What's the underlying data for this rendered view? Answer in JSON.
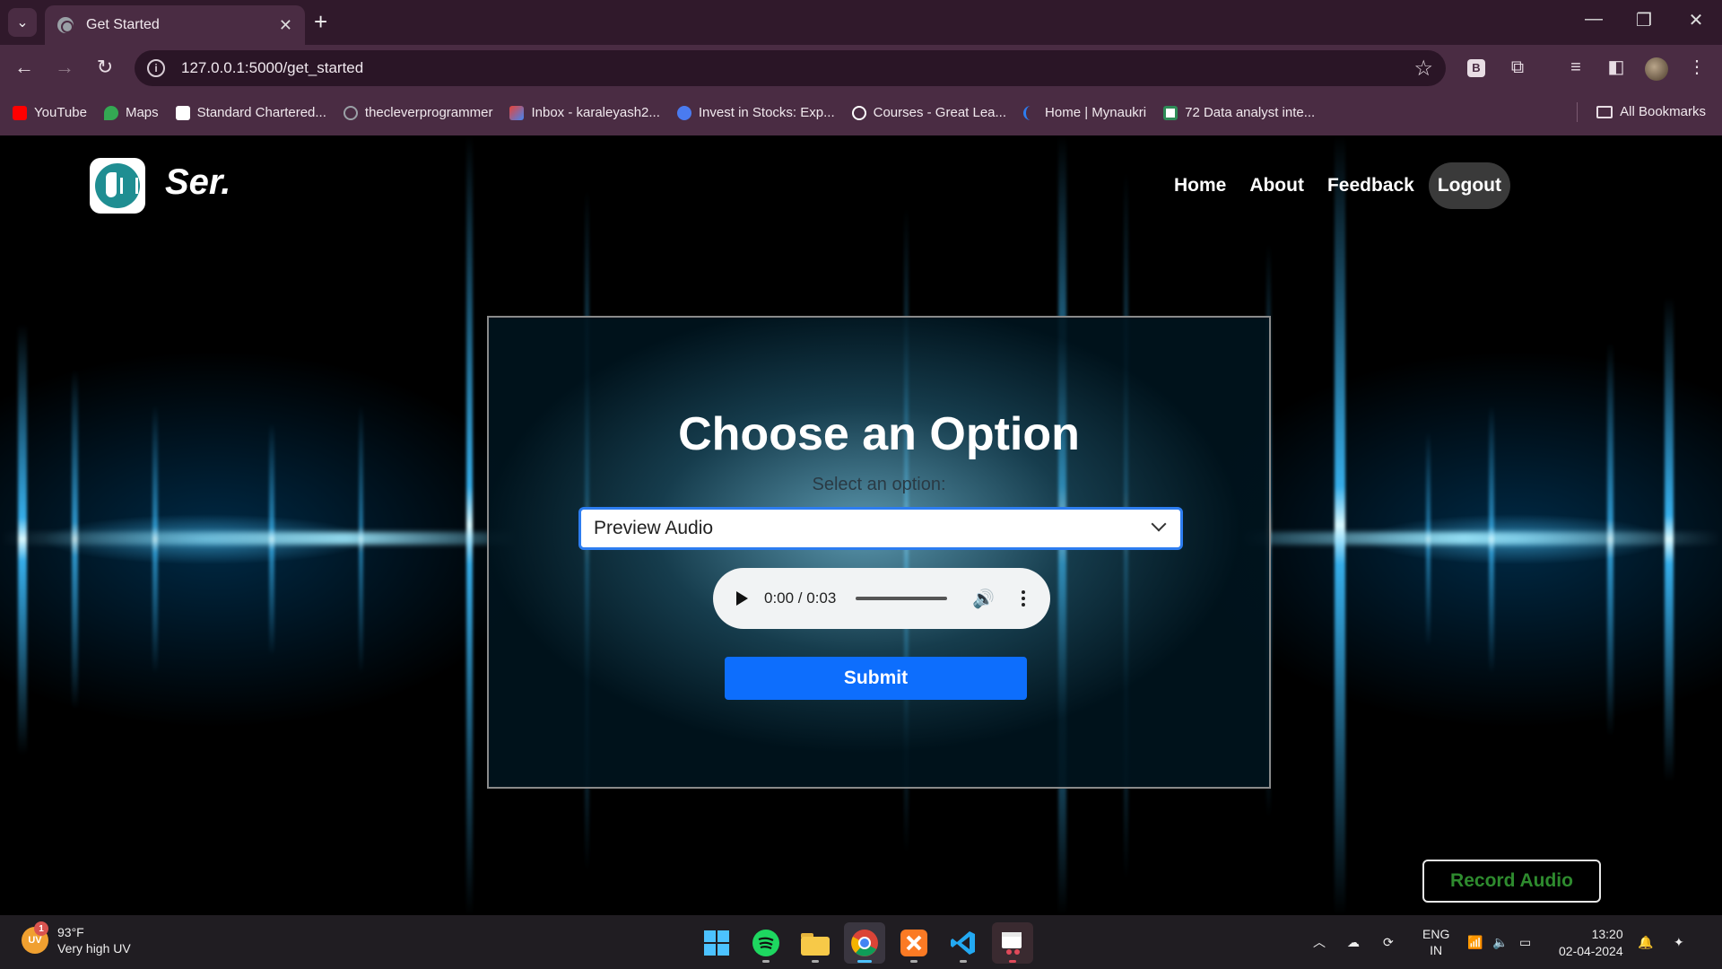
{
  "browser": {
    "tab_title": "Get Started",
    "url": "127.0.0.1:5000/get_started",
    "bookmarks": [
      {
        "label": "YouTube",
        "icon": "youtube-icon",
        "color": "#ff0000"
      },
      {
        "label": "Maps",
        "icon": "maps-icon",
        "color": "#34a853"
      },
      {
        "label": "Standard Chartered...",
        "icon": "standard-chartered-icon",
        "color": "#ffffff"
      },
      {
        "label": "thecleverprogrammer",
        "icon": "thecleverprogrammer-icon",
        "color": "#9aa0a6"
      },
      {
        "label": "Inbox - karaleyash2...",
        "icon": "gmail-icon",
        "color": "#ea4335"
      },
      {
        "label": "Invest in Stocks: Exp...",
        "icon": "stocks-icon",
        "color": "#4a7bf0"
      },
      {
        "label": "Courses - Great Lea...",
        "icon": "google-icon",
        "color": "#ffffff"
      },
      {
        "label": "Home | Mynaukri",
        "icon": "mynaukri-icon",
        "color": "#2d7df0"
      },
      {
        "label": "72 Data analyst inte...",
        "icon": "data-analyst-icon",
        "color": "#2e8b57"
      }
    ],
    "all_bookmarks": "All Bookmarks",
    "ext_label": "B"
  },
  "site": {
    "brand": "Ser.",
    "nav": [
      "Home",
      "About",
      "Feedback",
      "Logout"
    ],
    "heading": "Choose an Option",
    "select_label": "Select an option:",
    "selected_option": "Preview Audio",
    "audio_time": "0:00 / 0:03",
    "submit_label": "Submit",
    "record_label": "Record Audio"
  },
  "taskbar": {
    "weather_temp": "93°F",
    "weather_desc": "Very high UV",
    "uv_label": "UV",
    "uv_badge": "1",
    "lang_top": "ENG",
    "lang_bottom": "IN",
    "time": "13:20",
    "date": "02-04-2024"
  }
}
